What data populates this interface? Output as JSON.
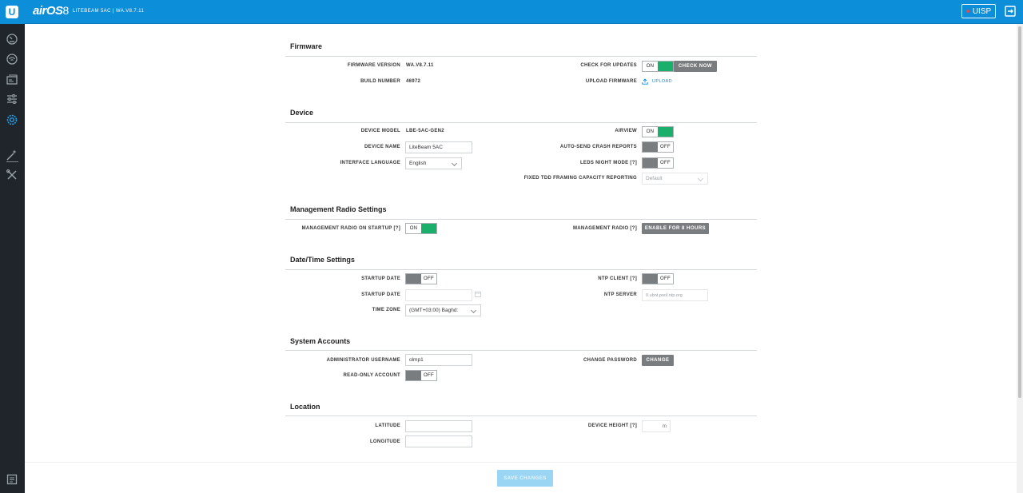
{
  "header": {
    "logo_letter": "U",
    "brand": "airOS",
    "brand_version": "8",
    "device_info": "LITEBEAM 5AC | WA.V8.7.11",
    "uisp_label": "UISP"
  },
  "sidebar": {
    "items": [
      {
        "icon": "dashboard-icon"
      },
      {
        "icon": "wireless-icon"
      },
      {
        "icon": "network-icon"
      },
      {
        "icon": "services-icon"
      },
      {
        "icon": "system-settings-icon",
        "active": true
      },
      {
        "icon": "tools-wand-icon"
      },
      {
        "icon": "tools-icon"
      },
      {
        "icon": "log-icon"
      }
    ]
  },
  "firmware": {
    "title": "Firmware",
    "version_label": "FIRMWARE VERSION",
    "version_value": "WA.V8.7.11",
    "build_label": "BUILD NUMBER",
    "build_value": "46972",
    "check_updates_label": "CHECK FOR UPDATES",
    "check_updates_state": "ON",
    "check_now_label": "CHECK NOW",
    "upload_label": "UPLOAD FIRMWARE",
    "upload_link": "UPLOAD"
  },
  "device": {
    "title": "Device",
    "model_label": "DEVICE MODEL",
    "model_value": "LBE-5AC-GEN2",
    "name_label": "DEVICE NAME",
    "name_value": "LiteBeam 5AC",
    "language_label": "INTERFACE LANGUAGE",
    "language_value": "English",
    "airview_label": "AIRVIEW",
    "airview_state": "ON",
    "crash_label": "AUTO-SEND CRASH REPORTS",
    "crash_state": "OFF",
    "leds_label": "LEDS NIGHT MODE [?]",
    "leds_state": "OFF",
    "tdd_label": "FIXED TDD FRAMING CAPACITY REPORTING",
    "tdd_value": "Default"
  },
  "mgmt_radio": {
    "title": "Management Radio Settings",
    "startup_label": "MANAGEMENT RADIO ON STARTUP [?]",
    "startup_state": "ON",
    "radio_label": "MANAGEMENT RADIO [?]",
    "enable_button": "ENABLE FOR 8 HOURS"
  },
  "datetime": {
    "title": "Date/Time Settings",
    "startup_date_toggle_label": "STARTUP DATE",
    "startup_date_toggle_state": "OFF",
    "startup_date_label": "STARTUP DATE",
    "timezone_label": "TIME ZONE",
    "timezone_value": "(GMT+03:00) Baghd:",
    "ntp_client_label": "NTP CLIENT [?]",
    "ntp_client_state": "OFF",
    "ntp_server_label": "NTP SERVER",
    "ntp_server_placeholder": "0.ubnt.pool.ntp.org"
  },
  "accounts": {
    "title": "System Accounts",
    "admin_label": "ADMINISTRATOR USERNAME",
    "admin_value": "olmp1",
    "readonly_label": "READ-ONLY ACCOUNT",
    "readonly_state": "OFF",
    "change_pw_label": "CHANGE PASSWORD",
    "change_button": "CHANGE"
  },
  "location": {
    "title": "Location",
    "latitude_label": "LATITUDE",
    "longitude_label": "LONGITUDE",
    "height_label": "DEVICE HEIGHT [?]",
    "height_unit": "m"
  },
  "footer": {
    "save_label": "SAVE CHANGES"
  },
  "colors": {
    "header_blue": "#0c8ed9",
    "sidebar_dark": "#1f252b",
    "toggle_on": "#1ab06b",
    "toggle_off": "#7a7d80"
  }
}
